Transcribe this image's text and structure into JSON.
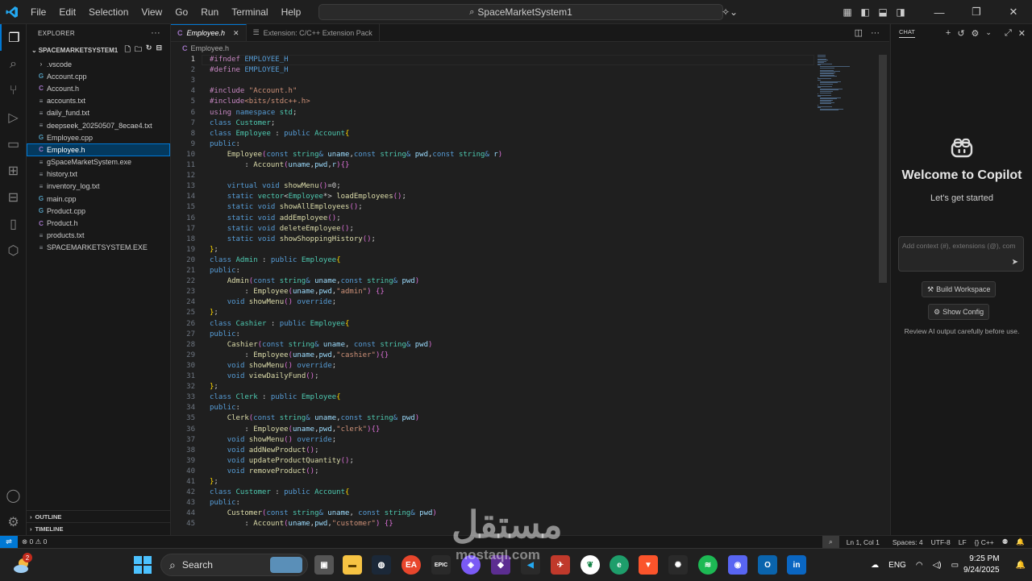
{
  "menu": [
    "File",
    "Edit",
    "Selection",
    "View",
    "Go",
    "Run",
    "Terminal",
    "Help"
  ],
  "command_center": "SpaceMarketSystem1",
  "explorer": {
    "title": "EXPLORER",
    "root": "SPACEMARKETSYSTEM1",
    "files": [
      {
        "name": ".vscode",
        "icon": "chevron-right-icon",
        "glyph": "›",
        "cls": "chev"
      },
      {
        "name": "Account.cpp",
        "icon": "cpp-file-icon",
        "glyph": "G",
        "cls": "cpp"
      },
      {
        "name": "Account.h",
        "icon": "c-header-file-icon",
        "glyph": "C",
        "cls": "c"
      },
      {
        "name": "accounts.txt",
        "icon": "text-file-icon",
        "glyph": "≡",
        "cls": "txt"
      },
      {
        "name": "daily_fund.txt",
        "icon": "text-file-icon",
        "glyph": "≡",
        "cls": "txt"
      },
      {
        "name": "deepseek_20250507_8ecae4.txt",
        "icon": "text-file-icon",
        "glyph": "≡",
        "cls": "txt"
      },
      {
        "name": "Employee.cpp",
        "icon": "cpp-file-icon",
        "glyph": "G",
        "cls": "cpp"
      },
      {
        "name": "Employee.h",
        "icon": "c-header-file-icon",
        "glyph": "C",
        "cls": "c",
        "selected": true
      },
      {
        "name": "gSpaceMarketSystem.exe",
        "icon": "exe-file-icon",
        "glyph": "≡",
        "cls": "exe"
      },
      {
        "name": "history.txt",
        "icon": "text-file-icon",
        "glyph": "≡",
        "cls": "txt"
      },
      {
        "name": "inventory_log.txt",
        "icon": "text-file-icon",
        "glyph": "≡",
        "cls": "txt"
      },
      {
        "name": "main.cpp",
        "icon": "cpp-file-icon",
        "glyph": "G",
        "cls": "cpp"
      },
      {
        "name": "Product.cpp",
        "icon": "cpp-file-icon",
        "glyph": "G",
        "cls": "cpp"
      },
      {
        "name": "Product.h",
        "icon": "c-header-file-icon",
        "glyph": "C",
        "cls": "c"
      },
      {
        "name": "products.txt",
        "icon": "text-file-icon",
        "glyph": "≡",
        "cls": "txt"
      },
      {
        "name": "SPACEMARKETSYSTEM.EXE",
        "icon": "exe-file-icon",
        "glyph": "≡",
        "cls": "exe"
      }
    ],
    "outline": "OUTLINE",
    "timeline": "TIMELINE"
  },
  "tabs": [
    {
      "label": "Employee.h",
      "active": true
    },
    {
      "label": "Extension: C/C++ Extension Pack",
      "active": false
    }
  ],
  "breadcrumb": "Employee.h",
  "code_lines": [
    "<span class=\"pp\">#ifndef</span> <span class=\"mac\">EMPLOYEE_H</span>",
    "<span class=\"pp\">#define</span> <span class=\"mac\">EMPLOYEE_H</span>",
    "",
    "<span class=\"pp\">#include</span> <span class=\"st\">\"Account.h\"</span>",
    "<span class=\"pp\">#include</span><span class=\"st\">&lt;bits/stdc++.h&gt;</span>",
    "<span class=\"pp\">using</span> <span class=\"kw\">namespace</span> <span class=\"ty\">std</span>;",
    "<span class=\"kw\">class</span> <span class=\"ty\">Customer</span>;",
    "<span class=\"kw\">class</span> <span class=\"ty\">Employee</span> : <span class=\"kw\">public</span> <span class=\"ty\">Account</span><span class=\"br2\">{</span>",
    "<span class=\"kw\">public</span>:",
    "    <span class=\"fn\">Employee</span><span class=\"br\">(</span><span class=\"kw\">const</span> <span class=\"ty\">string</span><span class=\"kw\">&amp;</span> <span class=\"pm\">uname</span>,<span class=\"kw\">const</span> <span class=\"ty\">string</span><span class=\"kw\">&amp;</span> <span class=\"pm\">pwd</span>,<span class=\"kw\">const</span> <span class=\"ty\">string</span><span class=\"kw\">&amp;</span> <span class=\"pm\">r</span><span class=\"br\">)</span>",
    "        : <span class=\"fn\">Account</span><span class=\"br\">(</span><span class=\"pm\">uname</span>,<span class=\"pm\">pwd</span>,<span class=\"pm\">r</span><span class=\"br\">)</span><span class=\"br\">{}</span>",
    "",
    "    <span class=\"kw\">virtual</span> <span class=\"kw\">void</span> <span class=\"fn\">showMenu</span><span class=\"br\">()</span>=0;",
    "    <span class=\"kw\">static</span> <span class=\"ty\">vector</span>&lt;<span class=\"ty\">Employee</span>*&gt; <span class=\"fn\">loadEmployees</span><span class=\"br\">()</span>;",
    "    <span class=\"kw\">static</span> <span class=\"kw\">void</span> <span class=\"fn\">showAllEmployees</span><span class=\"br\">()</span>;",
    "    <span class=\"kw\">static</span> <span class=\"kw\">void</span> <span class=\"fn\">addEmployee</span><span class=\"br\">()</span>;",
    "    <span class=\"kw\">static</span> <span class=\"kw\">void</span> <span class=\"fn\">deleteEmployee</span><span class=\"br\">()</span>;",
    "    <span class=\"kw\">static</span> <span class=\"kw\">void</span> <span class=\"fn\">showShoppingHistory</span><span class=\"br\">()</span>;",
    "<span class=\"br2\">}</span>;",
    "<span class=\"kw\">class</span> <span class=\"ty\">Admin</span> : <span class=\"kw\">public</span> <span class=\"ty\">Employee</span><span class=\"br2\">{</span>",
    "<span class=\"kw\">public</span>:",
    "    <span class=\"fn\">Admin</span><span class=\"br\">(</span><span class=\"kw\">const</span> <span class=\"ty\">string</span><span class=\"kw\">&amp;</span> <span class=\"pm\">uname</span>,<span class=\"kw\">const</span> <span class=\"ty\">string</span><span class=\"kw\">&amp;</span> <span class=\"pm\">pwd</span><span class=\"br\">)</span>",
    "        : <span class=\"fn\">Employee</span><span class=\"br\">(</span><span class=\"pm\">uname</span>,<span class=\"pm\">pwd</span>,<span class=\"st\">\"admin\"</span><span class=\"br\">)</span> <span class=\"br\">{}</span>",
    "    <span class=\"kw\">void</span> <span class=\"fn\">showMenu</span><span class=\"br\">()</span> <span class=\"kw\">override</span>;",
    "<span class=\"br2\">}</span>;",
    "<span class=\"kw\">class</span> <span class=\"ty\">Cashier</span> : <span class=\"kw\">public</span> <span class=\"ty\">Employee</span><span class=\"br2\">{</span>",
    "<span class=\"kw\">public</span>:",
    "    <span class=\"fn\">Cashier</span><span class=\"br\">(</span><span class=\"kw\">const</span> <span class=\"ty\">string</span><span class=\"kw\">&amp;</span> <span class=\"pm\">uname</span>, <span class=\"kw\">const</span> <span class=\"ty\">string</span><span class=\"kw\">&amp;</span> <span class=\"pm\">pwd</span><span class=\"br\">)</span>",
    "        : <span class=\"fn\">Employee</span><span class=\"br\">(</span><span class=\"pm\">uname</span>,<span class=\"pm\">pwd</span>,<span class=\"st\">\"cashier\"</span><span class=\"br\">)</span><span class=\"br\">{}</span>",
    "    <span class=\"kw\">void</span> <span class=\"fn\">showMenu</span><span class=\"br\">()</span> <span class=\"kw\">override</span>;",
    "    <span class=\"kw\">void</span> <span class=\"fn\">viewDailyFund</span><span class=\"br\">()</span>;",
    "<span class=\"br2\">}</span>;",
    "<span class=\"kw\">class</span> <span class=\"ty\">Clerk</span> : <span class=\"kw\">public</span> <span class=\"ty\">Employee</span><span class=\"br2\">{</span>",
    "<span class=\"kw\">public</span>:",
    "    <span class=\"fn\">Clerk</span><span class=\"br\">(</span><span class=\"kw\">const</span> <span class=\"ty\">string</span><span class=\"kw\">&amp;</span> <span class=\"pm\">uname</span>,<span class=\"kw\">const</span> <span class=\"ty\">string</span><span class=\"kw\">&amp;</span> <span class=\"pm\">pwd</span><span class=\"br\">)</span>",
    "        : <span class=\"fn\">Employee</span><span class=\"br\">(</span><span class=\"pm\">uname</span>,<span class=\"pm\">pwd</span>,<span class=\"st\">\"clerk\"</span><span class=\"br\">)</span><span class=\"br\">{}</span>",
    "    <span class=\"kw\">void</span> <span class=\"fn\">showMenu</span><span class=\"br\">()</span> <span class=\"kw\">override</span>;",
    "    <span class=\"kw\">void</span> <span class=\"fn\">addNewProduct</span><span class=\"br\">()</span>;",
    "    <span class=\"kw\">void</span> <span class=\"fn\">updateProductQuantity</span><span class=\"br\">()</span>;",
    "    <span class=\"kw\">void</span> <span class=\"fn\">removeProduct</span><span class=\"br\">()</span>;",
    "<span class=\"br2\">}</span>;",
    "<span class=\"kw\">class</span> <span class=\"ty\">Customer</span> : <span class=\"kw\">public</span> <span class=\"ty\">Account</span><span class=\"br2\">{</span>",
    "<span class=\"kw\">public</span>:",
    "    <span class=\"fn\">Customer</span><span class=\"br\">(</span><span class=\"kw\">const</span> <span class=\"ty\">string</span><span class=\"kw\">&amp;</span> <span class=\"pm\">uname</span>, <span class=\"kw\">const</span> <span class=\"ty\">string</span><span class=\"kw\">&amp;</span> <span class=\"pm\">pwd</span><span class=\"br\">)</span>",
    "        : <span class=\"fn\">Account</span><span class=\"br\">(</span><span class=\"pm\">uname</span>,<span class=\"pm\">pwd</span>,<span class=\"st\">\"customer\"</span><span class=\"br\">)</span> <span class=\"br\">{}</span>"
  ],
  "chat": {
    "header": "CHAT",
    "welcome": "Welcome to Copilot",
    "subtitle": "Let's get started",
    "input_placeholder": "Add context (#), extensions (@), com",
    "build_workspace": "Build Workspace",
    "show_config": "Show Config",
    "review_note": "Review AI output carefully before use."
  },
  "status": {
    "errors": "0",
    "warnings": "0",
    "position": "Ln 1, Col 1",
    "spaces": "Spaces: 4",
    "encoding": "UTF-8",
    "eol": "LF",
    "language": "C++"
  },
  "taskbar": {
    "search": "Search",
    "weather_badge": "2",
    "language": "ENG",
    "time": "9:25 PM",
    "date": "9/24/2025"
  },
  "watermark": {
    "arabic": "مستقل",
    "latin": "mostaql.com"
  },
  "colors": {
    "accent": "#0078d4",
    "selection": "#04395e",
    "status_remote": "#0078d4"
  }
}
